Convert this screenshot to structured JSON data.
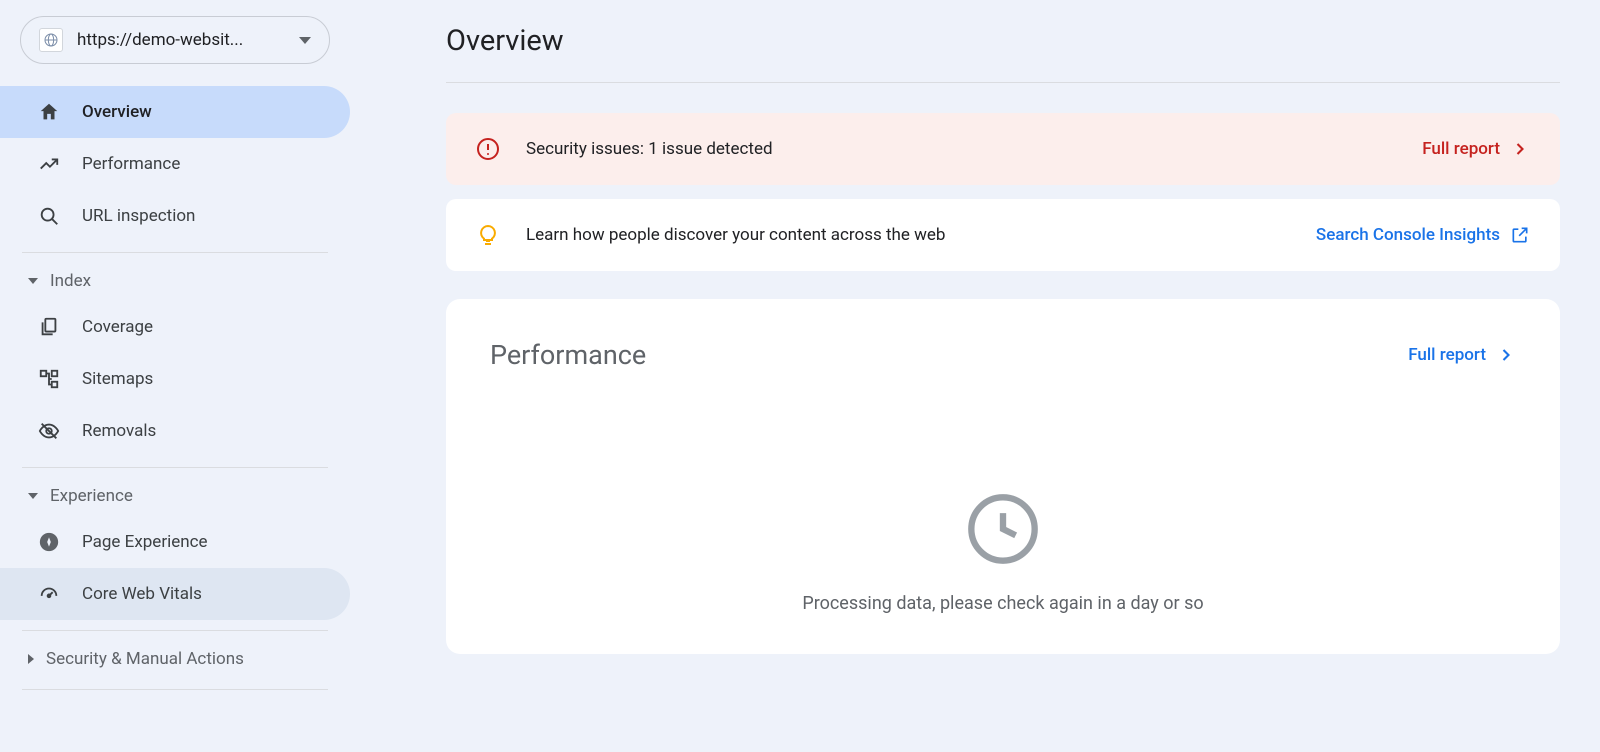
{
  "property_url": "https://demo-websit...",
  "page_title": "Overview",
  "nav": {
    "overview": "Overview",
    "performance": "Performance",
    "url_inspection": "URL inspection"
  },
  "sections": {
    "index": {
      "label": "Index",
      "items": {
        "coverage": "Coverage",
        "sitemaps": "Sitemaps",
        "removals": "Removals"
      }
    },
    "experience": {
      "label": "Experience",
      "items": {
        "page_experience": "Page Experience",
        "core_web_vitals": "Core Web Vitals"
      }
    },
    "security": {
      "label": "Security & Manual Actions"
    }
  },
  "banners": {
    "security": {
      "text": "Security issues: 1 issue detected",
      "link_label": "Full report"
    },
    "insights": {
      "text": "Learn how people discover your content across the web",
      "link_label": "Search Console Insights"
    }
  },
  "performance_card": {
    "title": "Performance",
    "link_label": "Full report",
    "message": "Processing data, please check again in a day or so"
  }
}
